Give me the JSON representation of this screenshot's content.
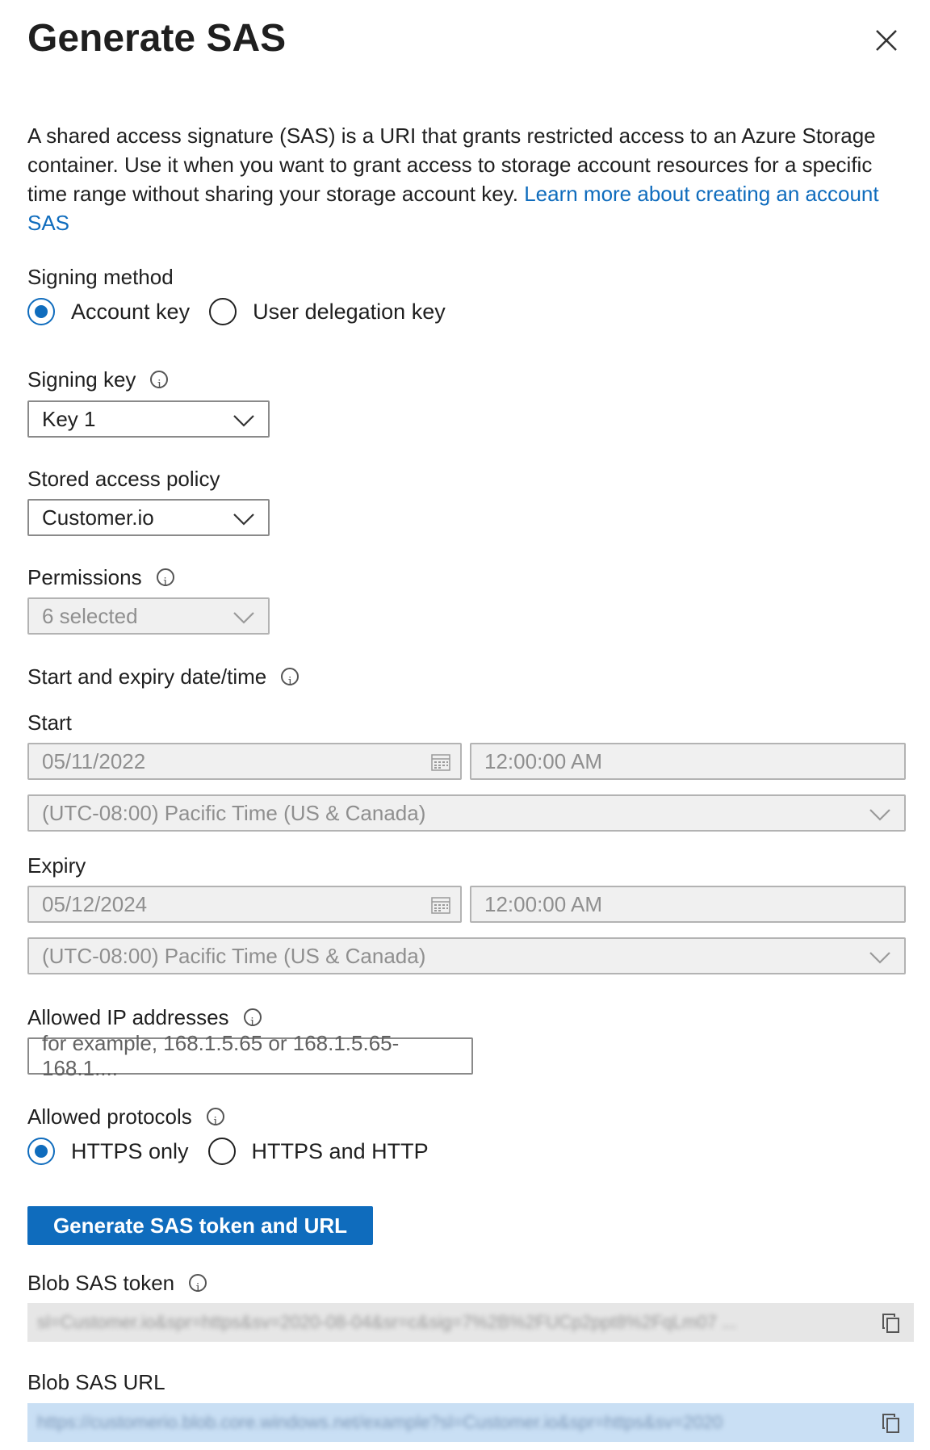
{
  "header": {
    "title": "Generate SAS"
  },
  "description": {
    "text": "A shared access signature (SAS) is a URI that grants restricted access to an Azure Storage container. Use it when you want to grant access to storage account resources for a specific time range without sharing your storage account key. ",
    "link": "Learn more about creating an account SAS"
  },
  "signing_method": {
    "label": "Signing method",
    "options": [
      "Account key",
      "User delegation key"
    ],
    "selected": "Account key"
  },
  "signing_key": {
    "label": "Signing key",
    "value": "Key 1"
  },
  "stored_access_policy": {
    "label": "Stored access policy",
    "value": "Customer.io"
  },
  "permissions": {
    "label": "Permissions",
    "value": "6 selected"
  },
  "start_expiry": {
    "label": "Start and expiry date/time",
    "start": {
      "label": "Start",
      "date": "05/11/2022",
      "time": "12:00:00 AM",
      "timezone": "(UTC-08:00) Pacific Time (US & Canada)"
    },
    "expiry": {
      "label": "Expiry",
      "date": "05/12/2024",
      "time": "12:00:00 AM",
      "timezone": "(UTC-08:00) Pacific Time (US & Canada)"
    }
  },
  "allowed_ip": {
    "label": "Allowed IP addresses",
    "placeholder": "for example, 168.1.5.65 or 168.1.5.65-168.1...."
  },
  "allowed_protocols": {
    "label": "Allowed protocols",
    "options": [
      "HTTPS only",
      "HTTPS and HTTP"
    ],
    "selected": "HTTPS only"
  },
  "generate_button": "Generate SAS token and URL",
  "blob_sas_token": {
    "label": "Blob SAS token",
    "value": "sl=Customer.io&spr=https&sv=2020-08-04&sr=c&sig=7%2B%2FUCp2ppt8%2FqLm07 ..."
  },
  "blob_sas_url": {
    "label": "Blob SAS URL",
    "value": "https://customerio.blob.core.windows.net/example?sl=Customer.io&spr=https&sv=2020"
  },
  "colors": {
    "accent": "#0f6cbd",
    "disabled_bg": "#f0f0f0",
    "selected_bg": "#c9dff4"
  }
}
